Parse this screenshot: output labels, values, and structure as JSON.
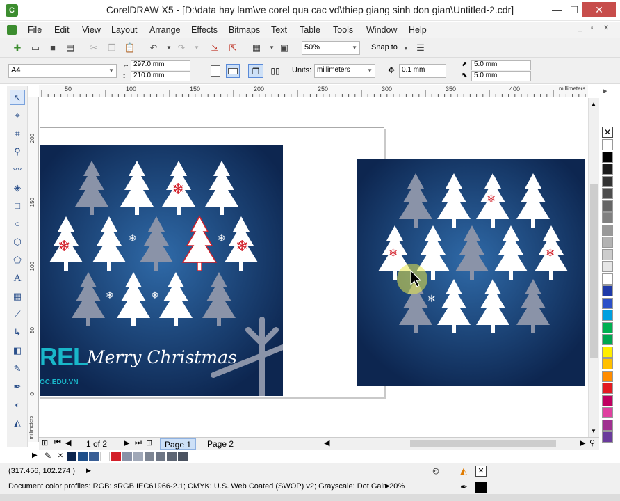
{
  "window": {
    "title": "CorelDRAW X5 - [D:\\data hay lam\\ve corel qua cac vd\\thiep giang sinh don gian\\Untitled-2.cdr]",
    "app_icon": "coreldraw-icon",
    "controls": [
      "minimize-icon",
      "maximize-icon",
      "close-icon"
    ]
  },
  "menu": [
    "File",
    "Edit",
    "View",
    "Layout",
    "Arrange",
    "Effects",
    "Bitmaps",
    "Text",
    "Table",
    "Tools",
    "Window",
    "Help"
  ],
  "toolbar": {
    "zoom": "50%",
    "snap_to": "Snap to"
  },
  "properties": {
    "page_size": "A4",
    "width": "297.0 mm",
    "height": "210.0 mm",
    "units_label": "Units:",
    "units_value": "millimeters",
    "nudge": "0.1 mm",
    "dup_x": "5.0 mm",
    "dup_y": "5.0 mm"
  },
  "ruler": {
    "h_ticks": [
      "50",
      "100",
      "150",
      "200",
      "250",
      "300",
      "350",
      "400"
    ],
    "h_unit": "millimeters",
    "v_ticks": [
      "200",
      "150",
      "100",
      "50",
      "0"
    ],
    "v_unit": "millimeters"
  },
  "canvas": {
    "card_text": "Merry Christmas",
    "card_logo": "REL",
    "card_site": "OC.EDU.VN",
    "card_bg": "#0d2650",
    "tree_white": "#ffffff",
    "tree_gray": "#8a93a8",
    "snowflake_red": "#d3202a"
  },
  "pages": {
    "counter": "1 of 2",
    "tabs": [
      "Page 1",
      "Page 2"
    ]
  },
  "status": {
    "coordinates": "(317.456, 102.274 )",
    "color_profiles": "Document color profiles: RGB: sRGB IEC61966-2.1; CMYK: U.S. Web Coated (SWOP) v2; Grayscale: Dot Gain 20%"
  },
  "palette_colors": [
    "#ffffff",
    "#000000",
    "#1a1a1a",
    "#333333",
    "#4d4d4d",
    "#666666",
    "#808080",
    "#999999",
    "#b3b3b3",
    "#cccccc",
    "#e6e6e6",
    "#ffffff",
    "#1f3aa8",
    "#2c50c8",
    "#00a0e0",
    "#00b050",
    "#00a650",
    "#ffee00",
    "#ffc000",
    "#ff8c00",
    "#e31b23",
    "#c00060",
    "#e040a0",
    "#a03090",
    "#6a3b9c"
  ]
}
